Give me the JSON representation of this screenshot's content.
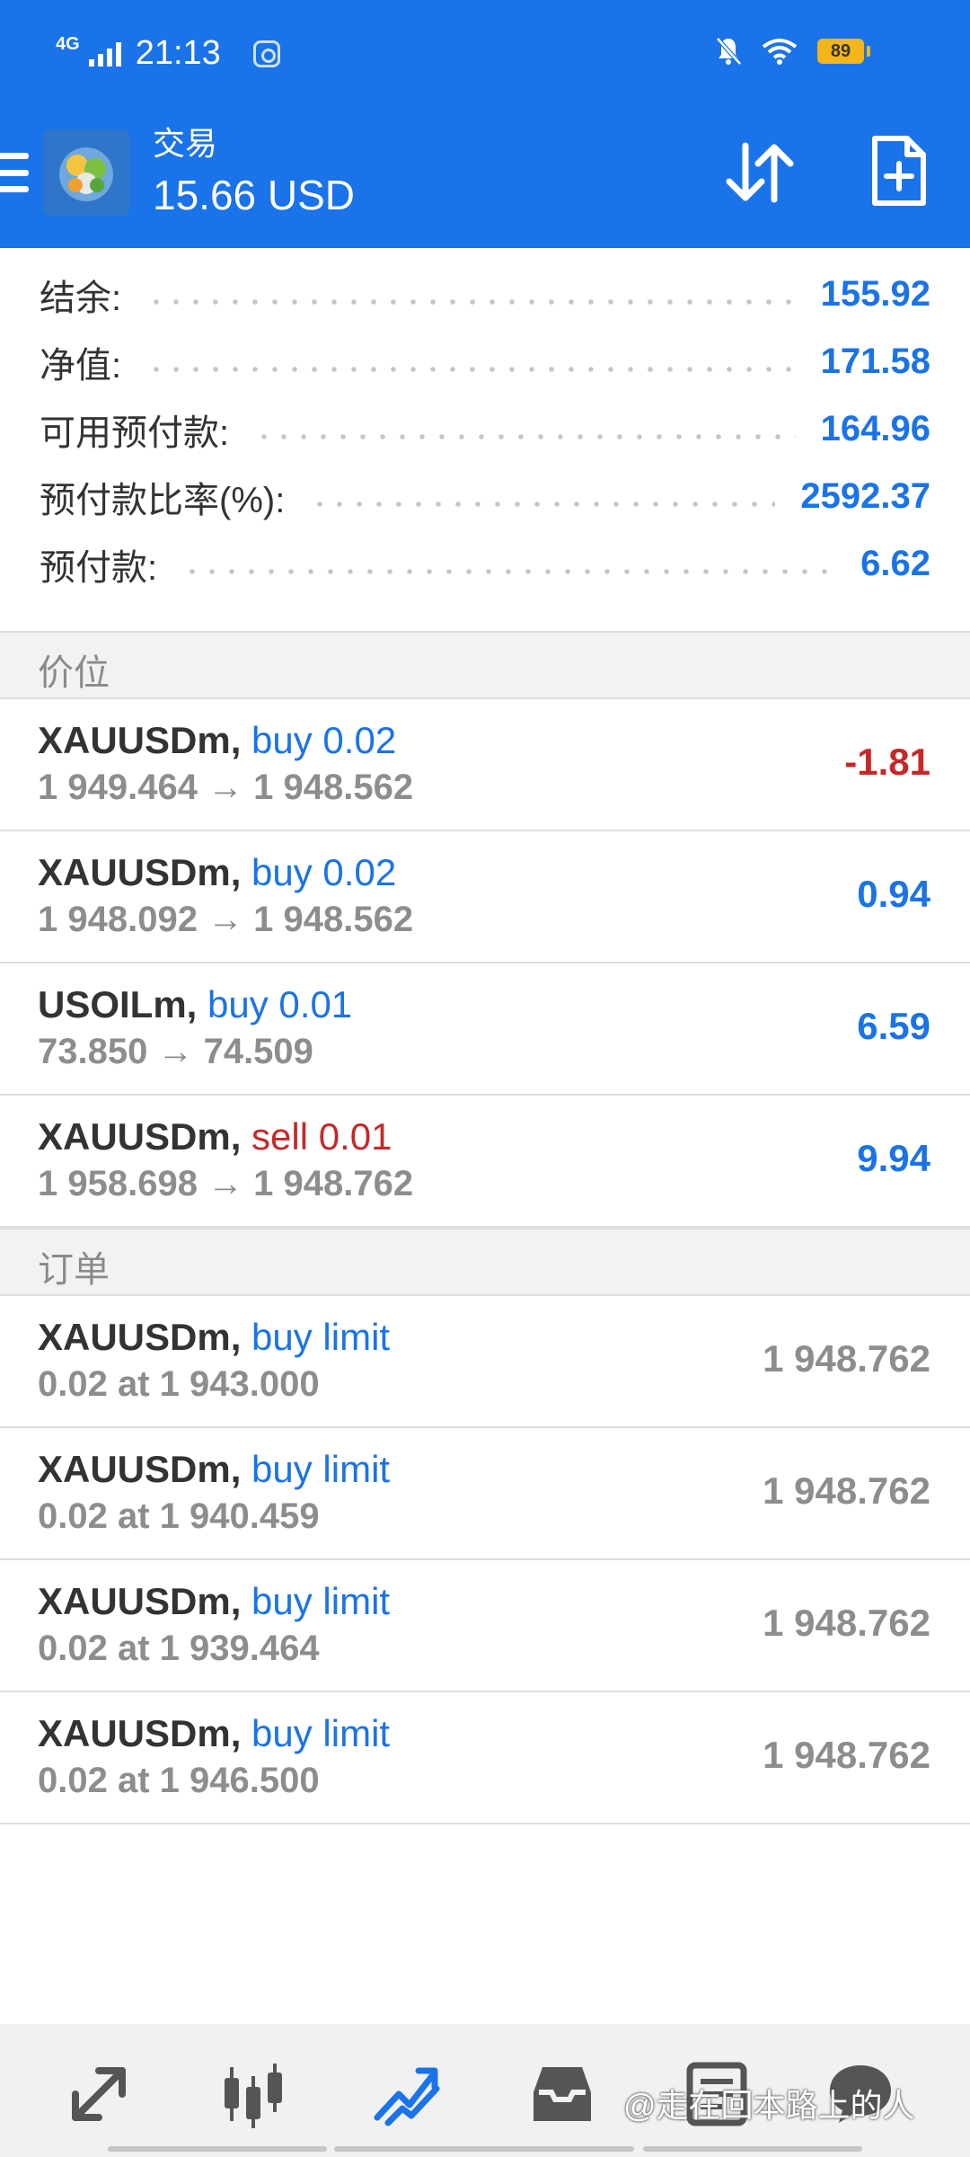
{
  "status_bar": {
    "network": "4G",
    "time": "21:13",
    "battery": "89"
  },
  "header": {
    "title": "交易",
    "balance_display": "15.66 USD"
  },
  "account": [
    {
      "label": "结余:",
      "value": "155.92"
    },
    {
      "label": "净值:",
      "value": "171.58"
    },
    {
      "label": "可用预付款:",
      "value": "164.96"
    },
    {
      "label": "预付款比率(%):",
      "value": "2592.37"
    },
    {
      "label": "预付款:",
      "value": "6.62"
    }
  ],
  "positions_section": "价位",
  "positions": [
    {
      "symbol": "XAUUSDm,",
      "action": "buy 0.02",
      "side": "buy",
      "prices": "1 949.464 → 1 948.562",
      "profit": "-1.81",
      "sign": "neg"
    },
    {
      "symbol": "XAUUSDm,",
      "action": "buy 0.02",
      "side": "buy",
      "prices": "1 948.092 → 1 948.562",
      "profit": "0.94",
      "sign": "pos"
    },
    {
      "symbol": "USOILm,",
      "action": "buy 0.01",
      "side": "buy",
      "prices": "73.850 → 74.509",
      "profit": "6.59",
      "sign": "pos"
    },
    {
      "symbol": "XAUUSDm,",
      "action": "sell 0.01",
      "side": "sell",
      "prices": "1 958.698 → 1 948.762",
      "profit": "9.94",
      "sign": "pos"
    }
  ],
  "orders_section": "订单",
  "orders": [
    {
      "symbol": "XAUUSDm,",
      "action": "buy limit",
      "detail": "0.02 at 1 943.000",
      "price": "1 948.762"
    },
    {
      "symbol": "XAUUSDm,",
      "action": "buy limit",
      "detail": "0.02 at 1 940.459",
      "price": "1 948.762"
    },
    {
      "symbol": "XAUUSDm,",
      "action": "buy limit",
      "detail": "0.02 at 1 939.464",
      "price": "1 948.762"
    },
    {
      "symbol": "XAUUSDm,",
      "action": "buy limit",
      "detail": "0.02 at 1 946.500",
      "price": "1 948.762"
    }
  ],
  "bottom_nav": [
    {
      "name": "quotes-icon",
      "active": false
    },
    {
      "name": "chart-icon",
      "active": false
    },
    {
      "name": "trade-icon",
      "active": true
    },
    {
      "name": "history-icon",
      "active": false
    },
    {
      "name": "news-icon",
      "active": false
    },
    {
      "name": "messages-icon",
      "active": false
    }
  ],
  "watermark": "@走在回本路上的人",
  "colors": {
    "header_bg": "#1a73e8",
    "accent_blue": "#1a73e8",
    "loss_red": "#c62828",
    "muted_grey": "#8d8d8d"
  }
}
